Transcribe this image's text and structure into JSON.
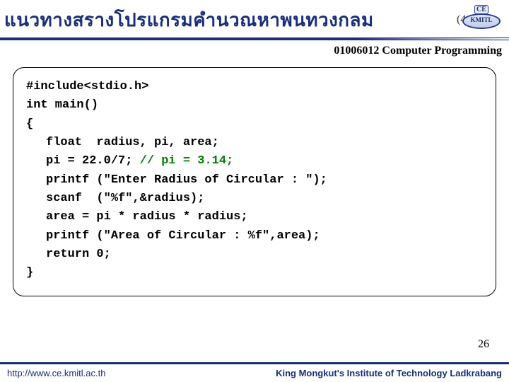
{
  "header": {
    "title": "แนวทางสรางโปรแกรมคำนวณหาพนทวงกลม",
    "logo_top": "CE",
    "logo_bottom": "KMITL",
    "logo_paren": "(4"
  },
  "subheader": "01006012 Computer Programming",
  "code": {
    "l1": "#include<stdio.h>",
    "l2": "int main()",
    "l3": "{",
    "l4": "float  radius, pi, area;",
    "l5a": "pi = 22.0/7; ",
    "l5b": "// pi = 3.14;",
    "l6": "printf (\"Enter Radius of Circular : \");",
    "l7": "scanf  (\"%f\",&radius);",
    "l8": "area = pi * radius * radius;",
    "l9": "printf (\"Area of Circular : %f\",area);",
    "l10": "return 0;",
    "l11": "}"
  },
  "page_number": "26",
  "footer": {
    "left": "http://www.ce.kmitl.ac.th",
    "right": "King Mongkut's Institute of Technology Ladkrabang"
  }
}
